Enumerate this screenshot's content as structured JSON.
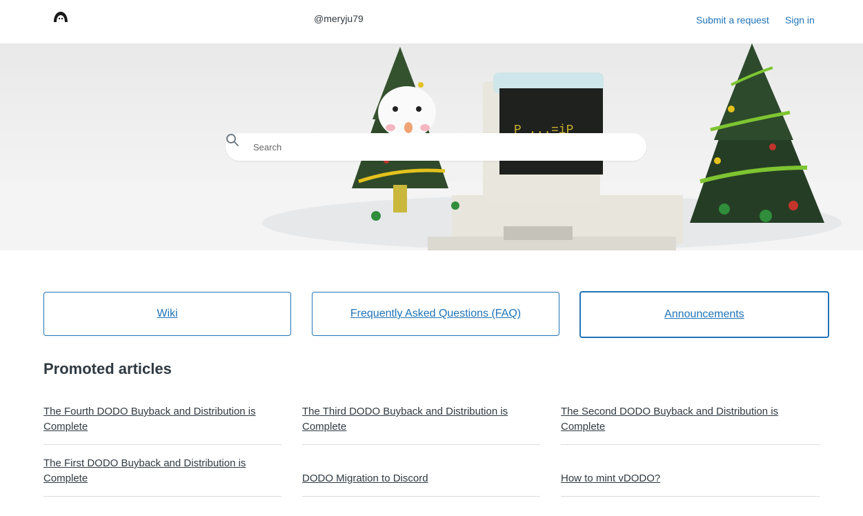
{
  "header": {
    "username": "@meryju79",
    "nav": {
      "submit_request": "Submit a request",
      "sign_in": "Sign in"
    }
  },
  "hero": {
    "search": {
      "placeholder": "Search",
      "value": ""
    }
  },
  "blocks": [
    {
      "label": "Wiki"
    },
    {
      "label": "Frequently Asked Questions (FAQ)"
    },
    {
      "label": "Announcements"
    }
  ],
  "promoted": {
    "title": "Promoted articles",
    "articles": [
      {
        "title": "The Fourth DODO Buyback and Distribution is Complete"
      },
      {
        "title": "The Third DODO Buyback and Distribution is Complete"
      },
      {
        "title": "The Second DODO Buyback and Distribution is Complete"
      },
      {
        "title": "The First DODO Buyback and Distribution is Complete"
      },
      {
        "title": "DODO Migration to Discord"
      },
      {
        "title": "How to mint vDODO?"
      }
    ]
  },
  "colors": {
    "link": "#1f73b7",
    "text": "#2f3941",
    "divider": "#d8dcde"
  },
  "icons": {
    "logo": "dodo-logo-icon",
    "search": "search-icon"
  }
}
